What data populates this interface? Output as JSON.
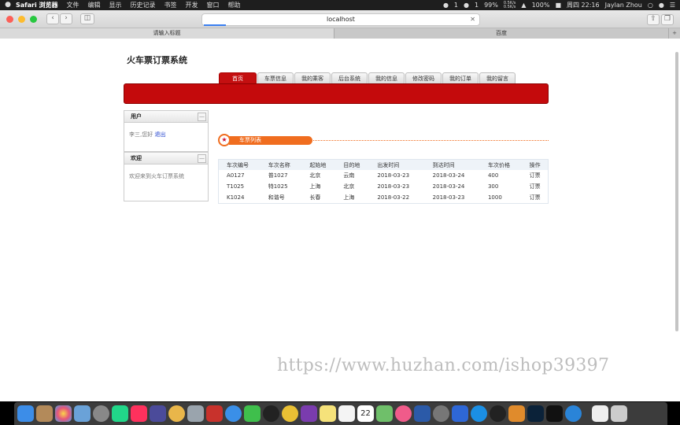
{
  "menubar": {
    "apple": "",
    "app": "Safari 浏览器",
    "items": [
      "文件",
      "编辑",
      "显示",
      "历史记录",
      "书签",
      "开发",
      "窗口",
      "帮助"
    ],
    "status": {
      "bell_count": "1",
      "wechat_count": "1",
      "battery_small": "99%",
      "net_up": "0.5K/s",
      "net_down": "0.5K/s",
      "battery": "100%",
      "clock": "周四 22:16",
      "user": "Jaylan Zhou"
    }
  },
  "browser": {
    "url": "localhost",
    "tabs": [
      "请输入标题",
      "百度"
    ],
    "new_tab": "+"
  },
  "page": {
    "site_title": "火车票订票系统",
    "nav": [
      "首页",
      "车票信息",
      "我的乘客",
      "后台系统",
      "我的信息",
      "修改密码",
      "我的订单",
      "我的留言"
    ],
    "user_box": {
      "title": "用户",
      "greeting": "李三,您好",
      "logout": "退出",
      "minimize": "—"
    },
    "welcome_box": {
      "title": "欢迎",
      "text": "欢迎来到火车订票系统",
      "minimize": "—"
    },
    "section_title": "车票列表",
    "table": {
      "headers": [
        "车次编号",
        "车次名称",
        "起始地",
        "目的地",
        "出发时间",
        "到达时间",
        "车次价格",
        "操作"
      ],
      "rows": [
        [
          "A0127",
          "普1027",
          "北京",
          "云南",
          "2018-03-23",
          "2018-03-24",
          "400",
          "订票"
        ],
        [
          "T1025",
          "特1025",
          "上海",
          "北京",
          "2018-03-23",
          "2018-03-24",
          "300",
          "订票"
        ],
        [
          "K1024",
          "和谐号",
          "长春",
          "上海",
          "2018-03-22",
          "2018-03-23",
          "1000",
          "订票"
        ]
      ]
    }
  },
  "watermark": "https://www.huzhan.com/ishop39397",
  "dock": {
    "apps": [
      "finder-icon",
      "notes-icon",
      "photos-icon",
      "preview-icon",
      "launchpad-icon",
      "pycharm-icon",
      "intellij-icon",
      "sublime-icon",
      "sequel-icon",
      "disk-icon",
      "redis-icon",
      "safari-icon",
      "wechat-icon",
      "qq-icon",
      "chrome-icon",
      "rp-icon",
      "notes2-icon",
      "reminders-icon",
      "calendar-icon",
      "maps-icon",
      "music-icon",
      "word-icon",
      "prefs-icon",
      "baidu-icon",
      "teamviewer-icon",
      "qq2-icon",
      "sublime2-icon",
      "ps-icon",
      "terminal-icon",
      "edge-icon",
      "docs-icon",
      "trash-icon"
    ],
    "calendar_day": "22"
  },
  "colors": {
    "brand_red": "#c40a0c",
    "section_orange": "#f06d1f",
    "link_blue": "#1a3ccc"
  }
}
